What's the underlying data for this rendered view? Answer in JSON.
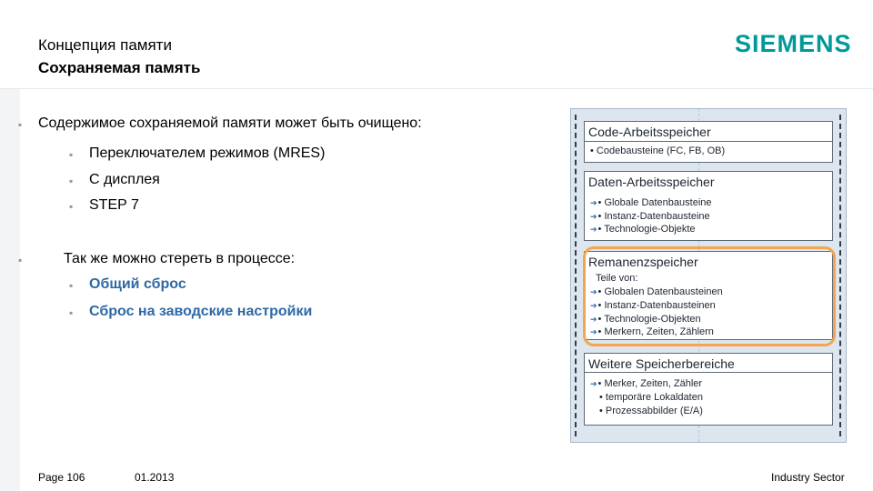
{
  "header": {
    "title": "Концепция памяти",
    "subtitle": "Сохраняемая память",
    "logo": "SIEMENS"
  },
  "bullets": [
    {
      "text": "Содержимое сохраняемой памяти может быть очищено:",
      "children": [
        {
          "text": "Переключателем режимов (MRES)",
          "style": "normal"
        },
        {
          "text": "С дисплея",
          "style": "normal"
        },
        {
          "text": "STEP 7",
          "style": "normal"
        }
      ]
    },
    {
      "text": "Так же можно стереть в процессе:",
      "children": [
        {
          "text": "Общий сброс",
          "style": "blue-bold"
        },
        {
          "text": "Сброс на заводские настройки",
          "style": "blue-bold"
        }
      ]
    }
  ],
  "diagram": {
    "boxes": [
      {
        "title": "Code-Arbeitsspeicher",
        "items": [
          {
            "text": "Codebausteine (FC, FB, OB)",
            "arrow": false
          }
        ]
      },
      {
        "title": "Daten-Arbeitsspeicher",
        "items": [
          {
            "text": "Globale Datenbausteine",
            "arrow": true
          },
          {
            "text": "Instanz-Datenbausteine",
            "arrow": true
          },
          {
            "text": "Technologie-Objekte",
            "arrow": true
          }
        ]
      },
      {
        "title": "Remanenzspeicher",
        "subheading": "Teile von:",
        "items": [
          {
            "text": "Globalen Datenbausteinen",
            "arrow": true
          },
          {
            "text": "Instanz-Datenbausteinen",
            "arrow": true
          },
          {
            "text": "Technologie-Objekten",
            "arrow": true
          },
          {
            "text": "Merkern, Zeiten, Zählern",
            "arrow": true
          }
        ]
      },
      {
        "title": "Weitere Speicherbereiche",
        "items": [
          {
            "text": "Merker, Zeiten, Zähler",
            "arrow": true
          },
          {
            "text": "temporäre Lokaldaten",
            "arrow": false
          },
          {
            "text": "Prozessabbilder (E/A)",
            "arrow": false
          }
        ]
      }
    ],
    "bullet_glyph": "▪",
    "item_marker": "•",
    "arrow_glyph": "➔",
    "highlight_color": "#f3a550"
  },
  "footer": {
    "page": "Page 106",
    "date": "01.2013",
    "sector": "Industry Sector"
  },
  "colors": {
    "brand": "#009999",
    "accent_text": "#2e69a6"
  }
}
